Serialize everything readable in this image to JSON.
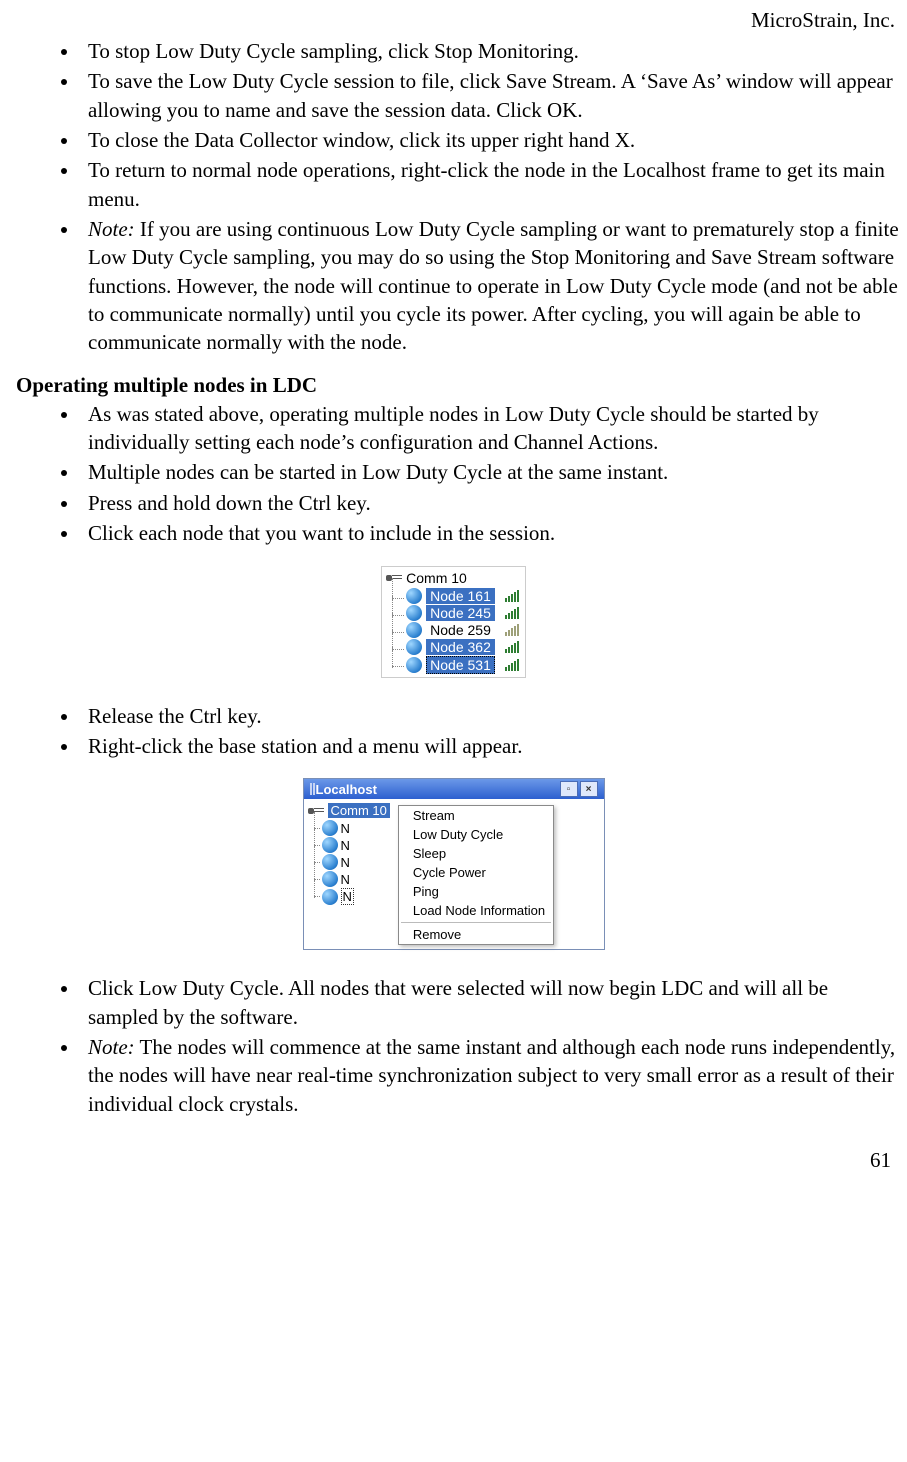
{
  "header": {
    "company": "MicroStrain, Inc."
  },
  "list1": {
    "b1": "To stop Low Duty Cycle sampling, click Stop Monitoring.",
    "b2": "To save the Low Duty Cycle session to file, click Save Stream. A ‘Save As’ window will appear allowing you to name and save the session data. Click OK.",
    "b3": "To close the Data Collector window, click its upper right hand X.",
    "b4": "To return to normal node operations, right-click the node in the Localhost frame to get its main menu.",
    "b5_note": "Note:",
    "b5_rest": " If you are using continuous Low Duty Cycle sampling or want to prematurely stop a finite Low Duty Cycle sampling, you may do so using the Stop Monitoring and Save Stream software functions. However, the node will continue to operate in Low Duty Cycle mode (and not be able to communicate normally) until you cycle its power. After cycling, you will again be able to communicate normally with the node."
  },
  "heading1": "Operating multiple nodes in LDC",
  "list2": {
    "b1": "As was stated above, operating multiple nodes in Low Duty Cycle should be started by individually setting each node’s configuration and Channel Actions.",
    "b2": "Multiple nodes can be started in Low Duty Cycle at the same instant.",
    "b3": "Press and hold down the Ctrl key.",
    "b4": "Click each node that you want to include in the session."
  },
  "tree1": {
    "root": "Comm 10",
    "nodes": [
      "Node 161",
      "Node 245",
      "Node 259",
      "Node 362",
      "Node 531"
    ]
  },
  "list3": {
    "b1": "Release the Ctrl key.",
    "b2": "Right-click the base station and a menu will appear."
  },
  "window": {
    "title": "Localhost",
    "root_label": "Comm 10",
    "node_letter": "N",
    "menu": {
      "m1": "Stream",
      "m2": "Low Duty Cycle",
      "m3": "Sleep",
      "m4": "Cycle Power",
      "m5": "Ping",
      "m6": "Load Node Information",
      "m7": "Remove"
    }
  },
  "list4": {
    "b1": "Click Low Duty Cycle. All nodes that were selected will now begin LDC and will all be sampled by the software.",
    "b2_note": "Note:",
    "b2_rest": " The nodes will commence at the same instant and although each node runs independently, the nodes will have near real-time synchronization subject to very small error as a result of their individual clock crystals."
  },
  "page_number": "61"
}
